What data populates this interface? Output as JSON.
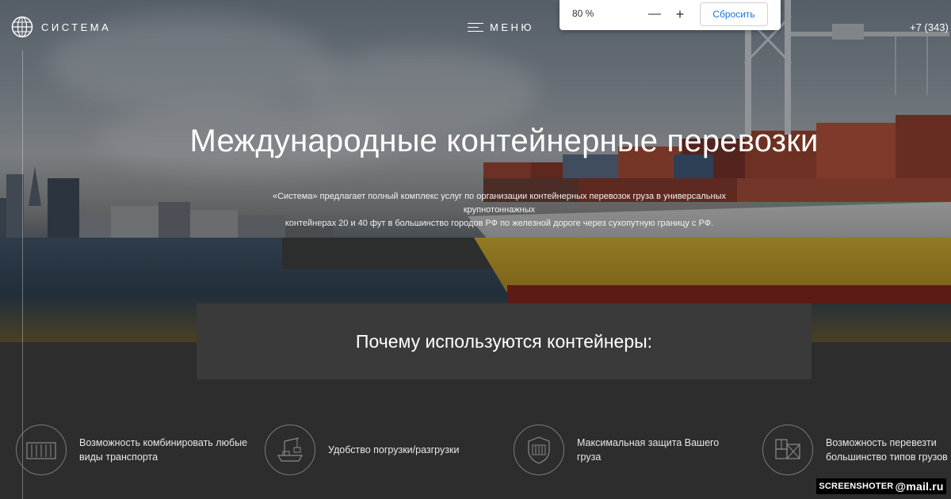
{
  "header": {
    "logo_text": "СИСТЕМА",
    "menu_label": "МЕНЮ",
    "phone": "+7 (343)"
  },
  "zoom_popup": {
    "level": "80 %",
    "minus": "—",
    "plus": "+",
    "reset_label": "Сбросить"
  },
  "hero": {
    "title": "Международные контейнерные перевозки",
    "description_line1": "«Система» предлагает полный комплекс услуг по организации контейнерных перевозок груза в универсальных крупнотоннажных",
    "description_line2": "контейнерах 20 и 40 фут в большинство городов РФ по железной дороге через сухопутную границу с РФ."
  },
  "why": {
    "title": "Почему используются контейнеры:"
  },
  "features": [
    {
      "icon": "container-icon",
      "line1": "Возможность комбинировать любые",
      "line2": "виды транспорта"
    },
    {
      "icon": "crane-ship-icon",
      "line1": "Удобство погрузки/разгрузки",
      "line2": ""
    },
    {
      "icon": "shield-container-icon",
      "line1": "Максимальная защита Вашего",
      "line2": "груза"
    },
    {
      "icon": "cargo-boxes-icon",
      "line1": "Возможность перевезти",
      "line2": "большинство типов грузов"
    }
  ],
  "watermark": {
    "text": "SCREENSHOTER",
    "brand": "@mail.ru"
  },
  "colors": {
    "dark_bg": "#2d2d2d",
    "box_bg": "#3a3a3a",
    "link_blue": "#1a73e8"
  }
}
